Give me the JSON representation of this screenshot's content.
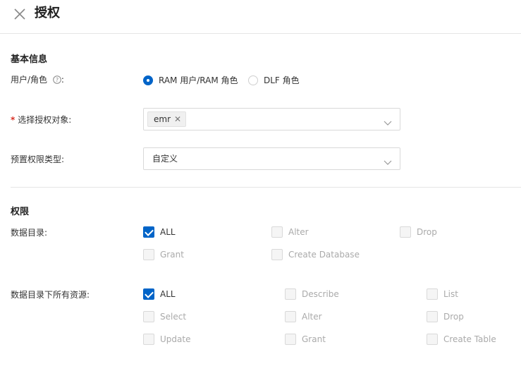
{
  "header": {
    "title": "授权"
  },
  "basic": {
    "section_title": "基本信息",
    "user_role_label": "用户/角色",
    "radio_options": [
      "RAM 用户/RAM 角色",
      "DLF 角色"
    ],
    "selected_radio": 0,
    "target_label": "选择授权对象:",
    "required_mark": "*",
    "target_tags": [
      "emr"
    ],
    "preset_label": "预置权限类型:",
    "preset_value": "自定义"
  },
  "permissions": {
    "section_title": "权限",
    "catalog_label": "数据目录:",
    "catalog_items": [
      {
        "label": "ALL",
        "checked": true
      },
      {
        "label": "Alter",
        "checked": false
      },
      {
        "label": "Drop",
        "checked": false
      },
      {
        "label": "Grant",
        "checked": false
      },
      {
        "label": "Create Database",
        "checked": false
      }
    ],
    "resources_label": "数据目录下所有资源:",
    "resource_items": [
      {
        "label": "ALL",
        "checked": true
      },
      {
        "label": "Describe",
        "checked": false
      },
      {
        "label": "List",
        "checked": false
      },
      {
        "label": "Select",
        "checked": false
      },
      {
        "label": "Alter",
        "checked": false
      },
      {
        "label": "Drop",
        "checked": false
      },
      {
        "label": "Update",
        "checked": false
      },
      {
        "label": "Grant",
        "checked": false
      },
      {
        "label": "Create Table",
        "checked": false
      }
    ]
  },
  "colors": {
    "accent": "#0064c8",
    "required": "#d93026"
  }
}
